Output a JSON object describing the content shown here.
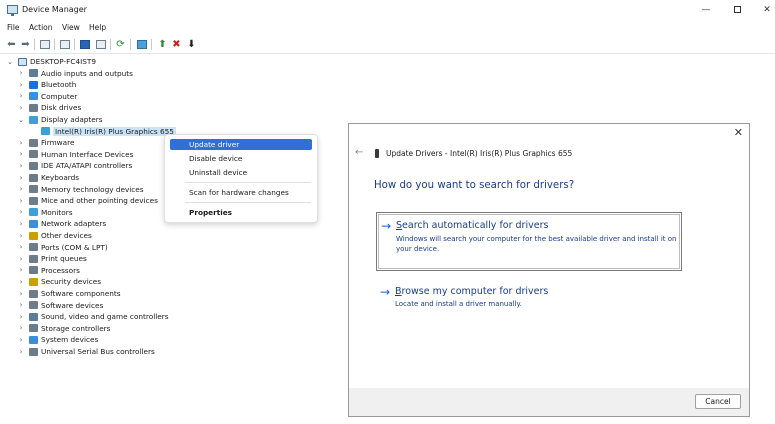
{
  "window": {
    "title": "Device Manager",
    "min_glyph": "—",
    "close_glyph": "✕"
  },
  "menu": [
    "File",
    "Action",
    "View",
    "Help"
  ],
  "tree": {
    "root": "DESKTOP-FC4IST9",
    "items": [
      {
        "label": "Audio inputs and outputs",
        "color": "#5a7d9a"
      },
      {
        "label": "Bluetooth",
        "color": "#1e6fd9"
      },
      {
        "label": "Computer",
        "color": "#3a8fd8"
      },
      {
        "label": "Disk drives",
        "color": "#6d7c89"
      },
      {
        "label": "Display adapters",
        "color": "#3f9fd9",
        "expanded": true
      },
      {
        "label": "Firmware",
        "color": "#6d7c89"
      },
      {
        "label": "Human Interface Devices",
        "color": "#6d7c89"
      },
      {
        "label": "IDE ATA/ATAPI controllers",
        "color": "#6d7c89"
      },
      {
        "label": "Keyboards",
        "color": "#6d7c89"
      },
      {
        "label": "Memory technology devices",
        "color": "#6d7c89"
      },
      {
        "label": "Mice and other pointing devices",
        "color": "#6d7c89"
      },
      {
        "label": "Monitors",
        "color": "#3f9fd9"
      },
      {
        "label": "Network adapters",
        "color": "#3a8fd8"
      },
      {
        "label": "Other devices",
        "color": "#c9a000"
      },
      {
        "label": "Ports (COM & LPT)",
        "color": "#6d7c89"
      },
      {
        "label": "Print queues",
        "color": "#6d7c89"
      },
      {
        "label": "Processors",
        "color": "#6d7c89"
      },
      {
        "label": "Security devices",
        "color": "#c9a000"
      },
      {
        "label": "Software components",
        "color": "#6d7c89"
      },
      {
        "label": "Software devices",
        "color": "#6d7c89"
      },
      {
        "label": "Sound, video and game controllers",
        "color": "#5a7d9a"
      },
      {
        "label": "Storage controllers",
        "color": "#6d7c89"
      },
      {
        "label": "System devices",
        "color": "#3a8fd8"
      },
      {
        "label": "Universal Serial Bus controllers",
        "color": "#6d7c89"
      }
    ],
    "child": "Intel(R) Iris(R) Plus Graphics 655"
  },
  "context_menu": [
    "Update driver",
    "Disable device",
    "Uninstall device",
    "Scan for hardware changes",
    "Properties"
  ],
  "dialog": {
    "close_glyph": "✕",
    "title": "Update Drivers - Intel(R) Iris(R) Plus Graphics 655",
    "heading": "How do you want to search for drivers?",
    "option1_title": "Search automatically for drivers",
    "option1_desc": "Windows will search your computer for the best available driver and install it on your device.",
    "option2_title": "Browse my computer for drivers",
    "option2_desc": "Locate and install a driver manually.",
    "cancel": "Cancel"
  },
  "colors": {
    "accent": "#2f6fd6",
    "link": "#1a3c8c",
    "delete": "#d01f1f",
    "enable": "#2d8a35"
  }
}
